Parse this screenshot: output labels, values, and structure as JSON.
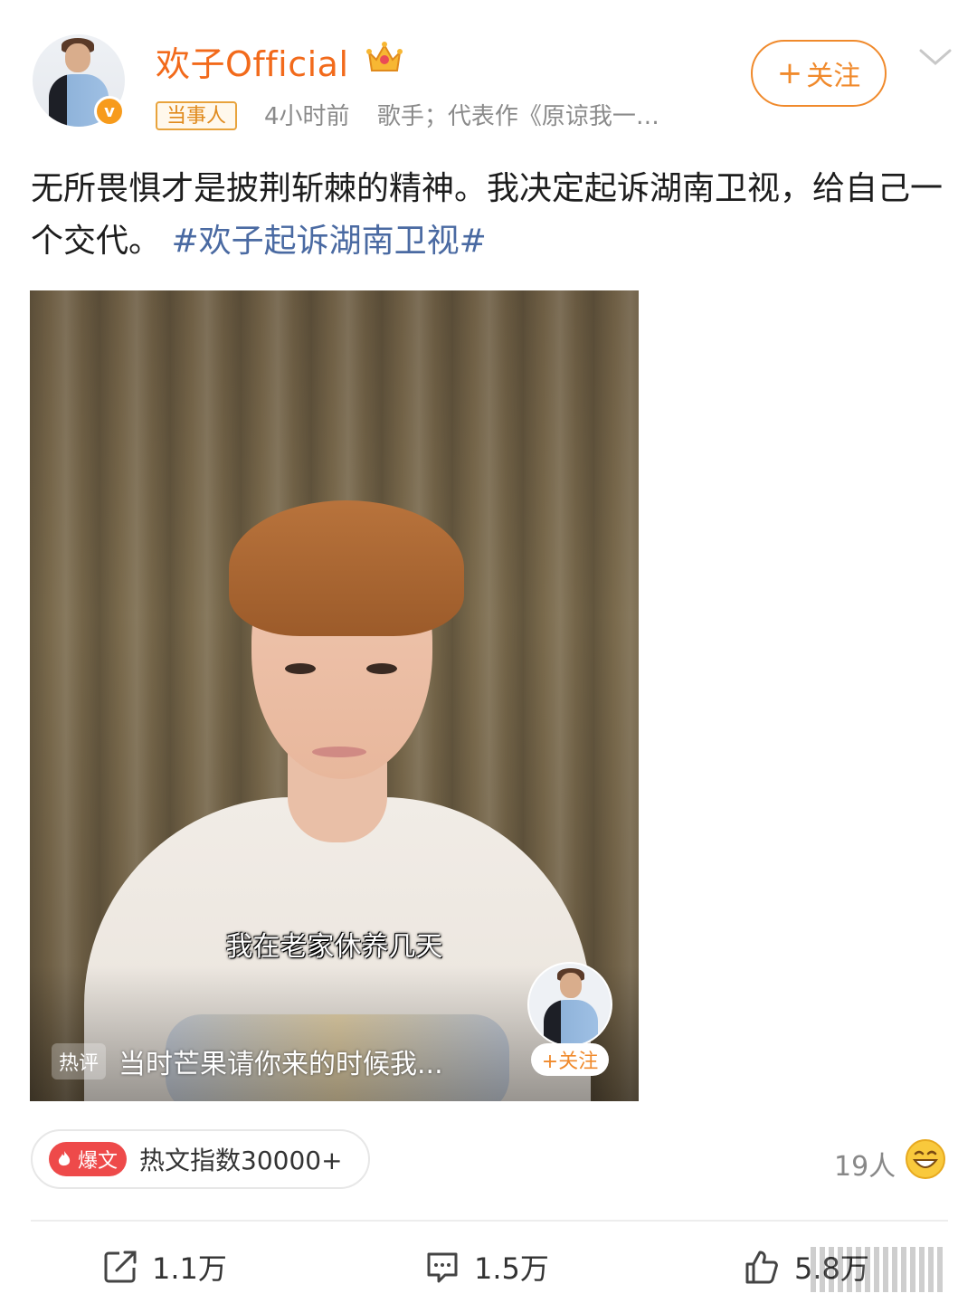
{
  "author": {
    "name": "欢子Official",
    "tag": "当事人",
    "time": "4小时前",
    "bio": "歌手；代表作《原谅我一…",
    "follow_label": "关注",
    "follow_plus": "+"
  },
  "post": {
    "text": "无所畏惧才是披荆斩棘的精神。我决定起诉湖南卫视，给自己一个交代。",
    "hashtag": "#欢子起诉湖南卫视#"
  },
  "video": {
    "subtitle": "我在老家休养几天",
    "hot_tag": "热评",
    "hot_comment": "当时芒果请你来的时候我...",
    "follow_label": "+关注"
  },
  "stats": {
    "badge": "爆文",
    "hot_index": "热文指数30000+",
    "people": "19人",
    "shares": "1.1万",
    "comments": "1.5万",
    "likes": "5.8万"
  },
  "colors": {
    "brand_orange": "#f26a1b",
    "hashtag_blue": "#4a6aa2",
    "badge_red": "#ee4a4a"
  },
  "icons": [
    "crown-icon",
    "verified-icon",
    "chevron-down-icon",
    "flame-icon",
    "grin-emoji-icon",
    "share-icon",
    "comment-icon",
    "like-icon"
  ]
}
